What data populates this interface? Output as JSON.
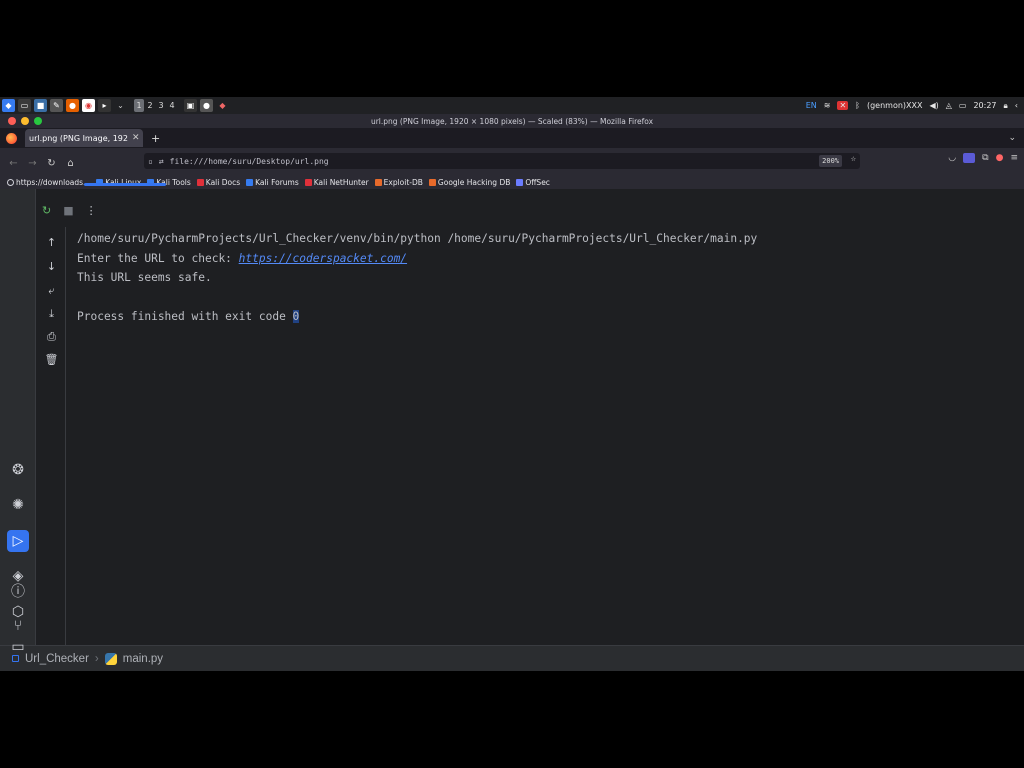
{
  "taskbar": {
    "workspaces": [
      "1",
      "2",
      "3",
      "4"
    ],
    "language": "EN",
    "genmon": "(genmon)XXX",
    "clock": "20:27"
  },
  "browser": {
    "window_title": "url.png (PNG Image, 1920 × 1080 pixels) — Scaled (83%) — Mozilla Firefox",
    "tab_title": "url.png (PNG Image, 192",
    "url": "file:///home/suru/Desktop/url.png",
    "zoom": "200%",
    "bookmarks": [
      {
        "label": "https://downloads...",
        "color": "#cfcfd8"
      },
      {
        "label": "Kali Linux",
        "color": "#367bf0"
      },
      {
        "label": "Kali Tools",
        "color": "#367bf0"
      },
      {
        "label": "Kali Docs",
        "color": "#e0303a"
      },
      {
        "label": "Kali Forums",
        "color": "#367bf0"
      },
      {
        "label": "Kali NetHunter",
        "color": "#e0303a"
      },
      {
        "label": "Exploit-DB",
        "color": "#e86a2b"
      },
      {
        "label": "Google Hacking DB",
        "color": "#e86a2b"
      },
      {
        "label": "OffSec",
        "color": "#6b7cff"
      }
    ]
  },
  "console": {
    "command": "/home/suru/PycharmProjects/Url_Checker/venv/bin/python /home/suru/PycharmProjects/Url_Checker/main.py",
    "prompt": "Enter the URL to check: ",
    "input_url": "https://coderspacket.com/",
    "result": "This URL seems safe.",
    "finished": "Process finished with exit code ",
    "exit_code": "0"
  },
  "statusbar": {
    "project": "Url_Checker",
    "file": "main.py"
  },
  "colors": {
    "accent": "#3574f0",
    "link": "#548af7",
    "ide_background": "#1e1f22",
    "tool_stripe": "#2b2d30"
  }
}
